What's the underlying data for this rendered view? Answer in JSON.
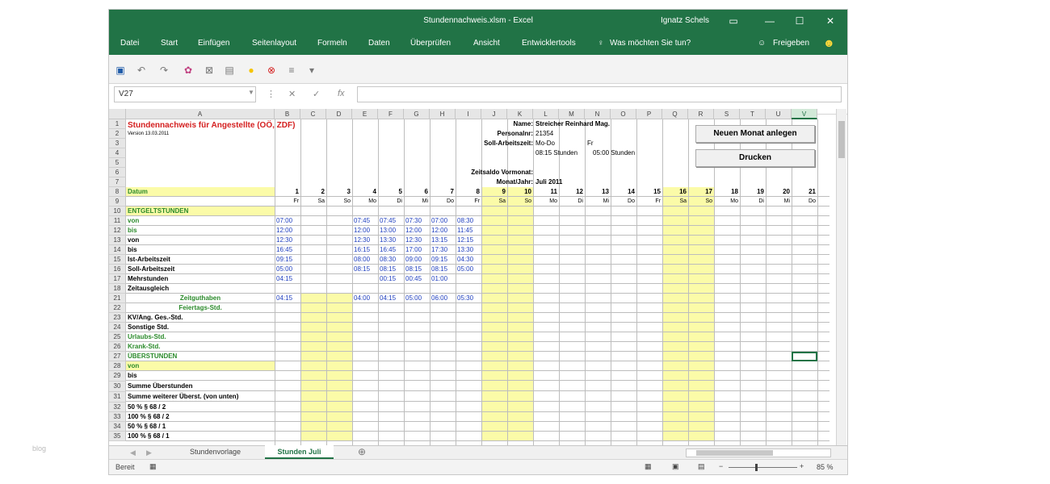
{
  "window": {
    "title": "Stundennachweis.xlsm  -  Excel",
    "user": "Ignatz Schels"
  },
  "menu": [
    "Datei",
    "Start",
    "Einfügen",
    "Seitenlayout",
    "Formeln",
    "Daten",
    "Überprüfen",
    "Ansicht",
    "Entwicklertools",
    "Was möchten Sie tun?",
    "Freigeben"
  ],
  "formula": {
    "name_box": "V27",
    "cancel": "✕",
    "enter": "✓",
    "fx": "fx"
  },
  "columns": [
    "A",
    "B",
    "C",
    "D",
    "E",
    "F",
    "G",
    "H",
    "I",
    "J",
    "K",
    "L",
    "M",
    "N",
    "O",
    "P",
    "Q",
    "R",
    "S",
    "T",
    "U",
    "V"
  ],
  "rows": [
    "1",
    "2",
    "3",
    "4",
    "5",
    "6",
    "7",
    "8",
    "9",
    "10",
    "11",
    "12",
    "13",
    "14",
    "15",
    "16",
    "17",
    "18",
    "21",
    "22",
    "23",
    "24",
    "25",
    "26",
    "27",
    "28",
    "29",
    "30",
    "31",
    "32",
    "33",
    "34",
    "35"
  ],
  "sheet": {
    "title": "Stundennachweis für Angestellte (OÖ, ZDF)",
    "version": "Version 13.03.2011",
    "name_label": "Name:",
    "name_value": "Streicher Reinhard Mag.",
    "pers_label": "Personalnr:",
    "pers_value": "21354",
    "soll_label": "Soll-Arbeitszeit:",
    "soll_days": "Mo-Do",
    "soll_fr": "Fr",
    "soll_hours": "08:15 Stunden",
    "soll_fr_hours": "05:00 Stunden",
    "saldo_label": "Zeitsaldo Vormonat:",
    "month_label": "Monat/Jahr:",
    "month_value": "Juli 2011",
    "btn_new": "Neuen Monat anlegen",
    "btn_print": "Drucken",
    "row_labels": [
      "Datum",
      "",
      "ENTGELTSTUNDEN",
      "von",
      "bis",
      "von",
      "bis",
      "Ist-Arbeitszeit",
      "Soll-Arbeitszeit",
      "Mehrstunden",
      "Zeitausgleich",
      "Zeitguthaben",
      "Feiertags-Std.",
      "KV/Ang. Ges.-Std.",
      "Sonstige Std.",
      "Urlaubs-Std.",
      "Krank-Std.",
      "ÜBERSTUNDEN",
      "von",
      "bis",
      "Summe Überstunden",
      "Summe weiterer Überst. (von unten)",
      "50 %   § 68 / 2",
      "100 %  § 68 / 2",
      "50 %   § 68 / 1",
      "100 %  § 68 / 1"
    ],
    "days": [
      "1",
      "2",
      "3",
      "4",
      "5",
      "6",
      "7",
      "8",
      "9",
      "10",
      "11",
      "12",
      "13",
      "14",
      "15",
      "16",
      "17",
      "18",
      "19",
      "20",
      "21"
    ],
    "weekdays": [
      "Fr",
      "Sa",
      "So",
      "Mo",
      "Di",
      "Mi",
      "Do",
      "Fr",
      "Sa",
      "So",
      "Mo",
      "Di",
      "Mi",
      "Do",
      "Fr",
      "Sa",
      "So",
      "Mo",
      "Di",
      "Mi",
      "Do"
    ],
    "data": {
      "row11": [
        "07:00",
        "",
        "",
        "07:45",
        "07:45",
        "07:30",
        "07:00",
        "08:30"
      ],
      "row12": [
        "12:00",
        "",
        "",
        "12:00",
        "13:00",
        "12:00",
        "12:00",
        "11:45"
      ],
      "row13": [
        "12:30",
        "",
        "",
        "12:30",
        "13:30",
        "12:30",
        "13:15",
        "12:15"
      ],
      "row14": [
        "16:45",
        "",
        "",
        "16:15",
        "16:45",
        "17:00",
        "17:30",
        "13:30"
      ],
      "row15": [
        "09:15",
        "",
        "",
        "08:00",
        "08:30",
        "09:00",
        "09:15",
        "04:30"
      ],
      "row16": [
        "05:00",
        "",
        "",
        "08:15",
        "08:15",
        "08:15",
        "08:15",
        "05:00"
      ],
      "row17": [
        "04:15",
        "",
        "",
        "",
        "00:15",
        "00:45",
        "01:00",
        ""
      ],
      "row21": [
        "04:15",
        "",
        "",
        "04:00",
        "04:15",
        "05:00",
        "06:00",
        "05:30"
      ]
    }
  },
  "tabs": [
    "Stundenvorlage",
    "Stunden Juli"
  ],
  "status": {
    "ready": "Bereit",
    "zoom": "85 %"
  },
  "watermark": "blog",
  "colors": {
    "excel_green": "#217346",
    "highlight": "#fbfba8",
    "label_green": "#2a8a2a",
    "value_blue": "#1f3fbf",
    "title_red": "#d42020"
  }
}
